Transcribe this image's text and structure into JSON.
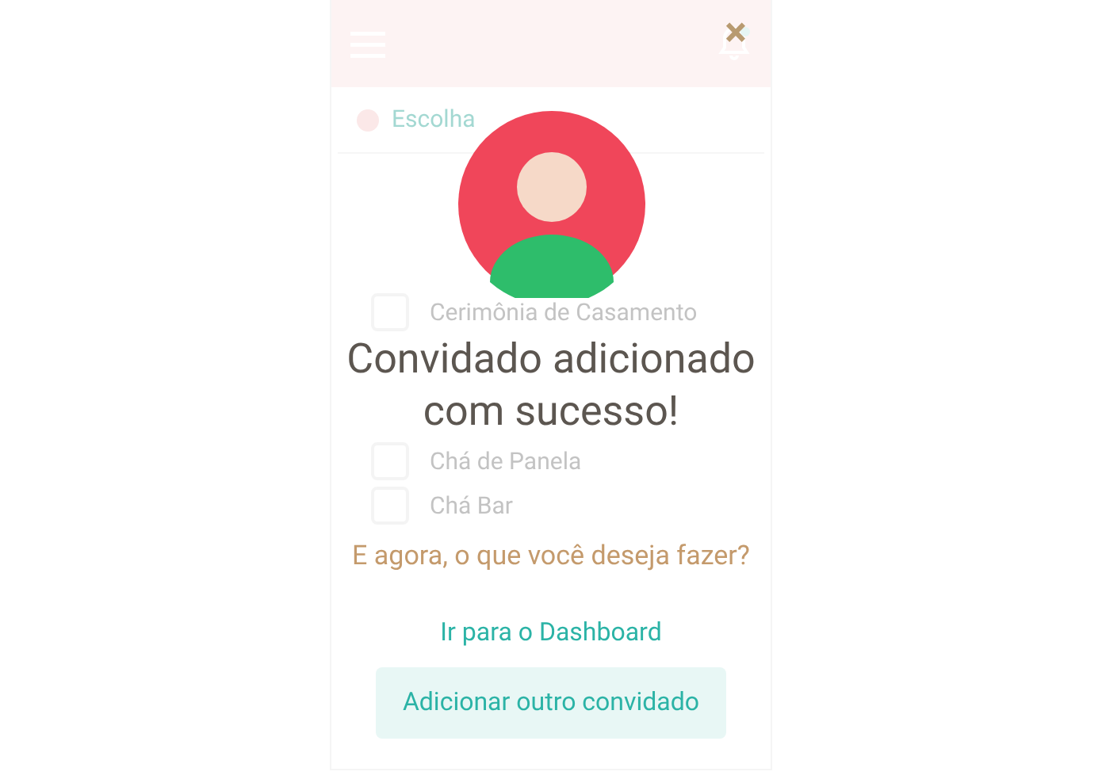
{
  "background": {
    "notice": "Escolha",
    "events": [
      {
        "label": "Cerimônia de Casamento",
        "checked": false
      },
      {
        "label": "Chá de Panela",
        "checked": false
      },
      {
        "label": "Chá Bar",
        "checked": false
      }
    ]
  },
  "modal": {
    "close": "×",
    "title": "Convidado adicionado com sucesso!",
    "question": "E agora, o que você deseja fazer?",
    "actions": [
      {
        "label": "Ir para o Dashboard",
        "kind": "link"
      },
      {
        "label": "Adicionar outro convidado",
        "kind": "button"
      }
    ]
  }
}
